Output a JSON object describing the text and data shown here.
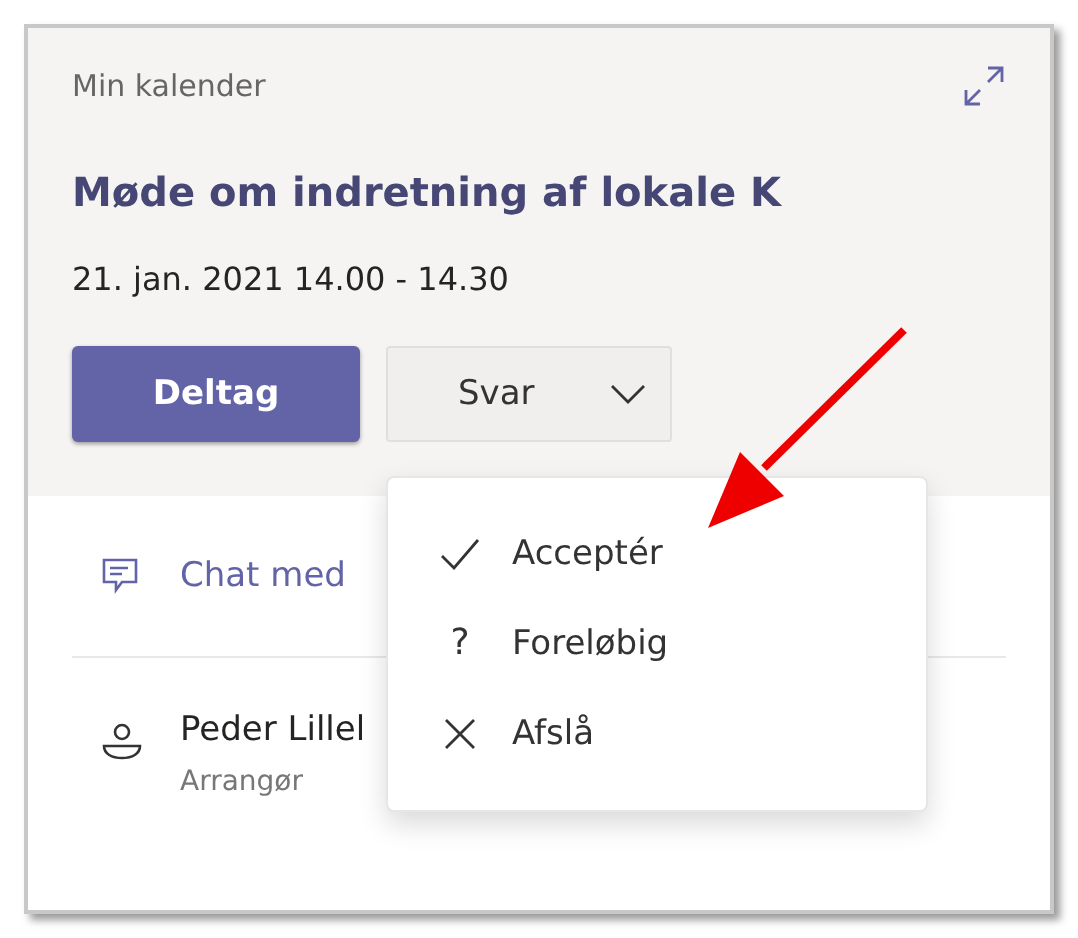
{
  "card": {
    "calendar_label": "Min kalender",
    "title": "Møde om indretning af lokale K",
    "datetime": "21. jan. 2021 14.00 - 14.30",
    "join_button": "Deltag",
    "respond_button": "Svar",
    "chat_link": "Chat med",
    "organizer": {
      "name": "Peder Lillel",
      "role": "Arrangør"
    }
  },
  "response_menu": [
    {
      "kind": "check",
      "label": "Acceptér"
    },
    {
      "kind": "glyph",
      "glyph": "?",
      "label": "Foreløbig"
    },
    {
      "kind": "cross",
      "label": "Afslå"
    }
  ]
}
